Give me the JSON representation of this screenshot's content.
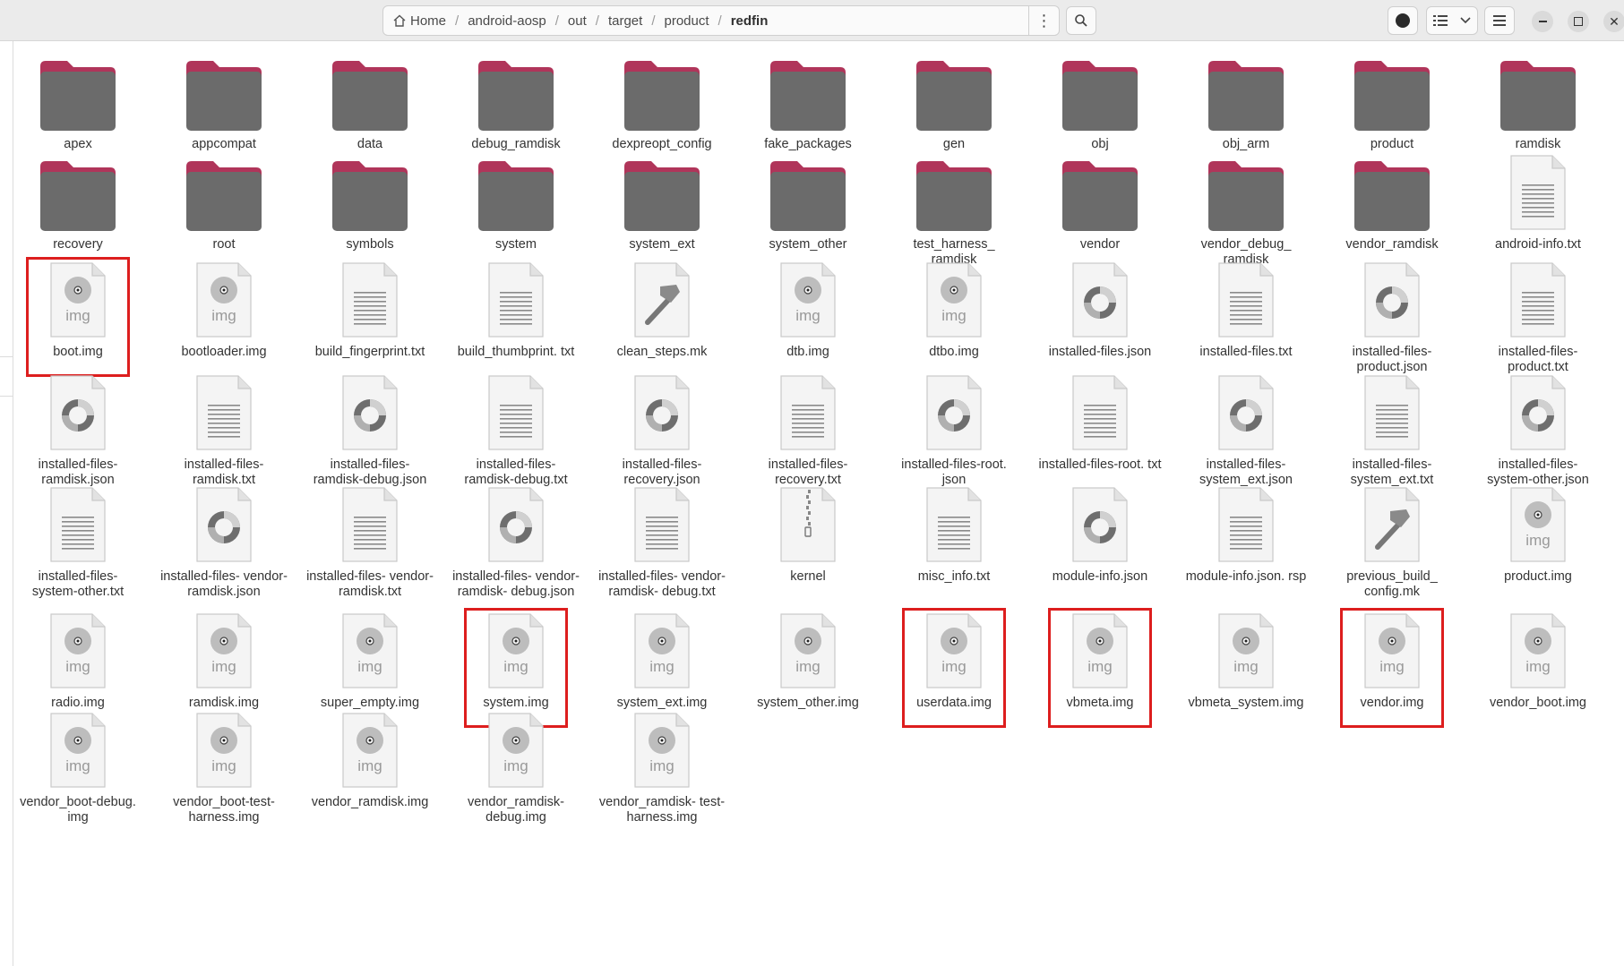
{
  "window": {
    "path": [
      "Home",
      "android-aosp",
      "out",
      "target",
      "product",
      "redfin"
    ],
    "colors": {
      "folder_tab": "#b0355a",
      "folder_body": "#6b6b6b",
      "selection": "#dd1e1e"
    }
  },
  "files": [
    {
      "name": "apex",
      "kind": "folder"
    },
    {
      "name": "appcompat",
      "kind": "folder"
    },
    {
      "name": "data",
      "kind": "folder"
    },
    {
      "name": "debug_ramdisk",
      "kind": "folder"
    },
    {
      "name": "dexpreopt_config",
      "kind": "folder"
    },
    {
      "name": "fake_packages",
      "kind": "folder"
    },
    {
      "name": "gen",
      "kind": "folder"
    },
    {
      "name": "obj",
      "kind": "folder"
    },
    {
      "name": "obj_arm",
      "kind": "folder"
    },
    {
      "name": "product",
      "kind": "folder"
    },
    {
      "name": "ramdisk",
      "kind": "folder"
    },
    {
      "name": "recovery",
      "kind": "folder"
    },
    {
      "name": "root",
      "kind": "folder"
    },
    {
      "name": "symbols",
      "kind": "folder"
    },
    {
      "name": "system",
      "kind": "folder"
    },
    {
      "name": "system_ext",
      "kind": "folder"
    },
    {
      "name": "system_other",
      "kind": "folder"
    },
    {
      "name": "test_harness_ ramdisk",
      "kind": "folder"
    },
    {
      "name": "vendor",
      "kind": "folder"
    },
    {
      "name": "vendor_debug_ ramdisk",
      "kind": "folder"
    },
    {
      "name": "vendor_ramdisk",
      "kind": "folder"
    },
    {
      "name": "android-info.txt",
      "kind": "text"
    },
    {
      "name": "boot.img",
      "kind": "img",
      "selected": true
    },
    {
      "name": "bootloader.img",
      "kind": "img"
    },
    {
      "name": "build_fingerprint.txt",
      "kind": "text"
    },
    {
      "name": "build_thumbprint. txt",
      "kind": "text"
    },
    {
      "name": "clean_steps.mk",
      "kind": "make"
    },
    {
      "name": "dtb.img",
      "kind": "img"
    },
    {
      "name": "dtbo.img",
      "kind": "img"
    },
    {
      "name": "installed-files.json",
      "kind": "json"
    },
    {
      "name": "installed-files.txt",
      "kind": "text"
    },
    {
      "name": "installed-files- product.json",
      "kind": "json"
    },
    {
      "name": "installed-files- product.txt",
      "kind": "text"
    },
    {
      "name": "installed-files- ramdisk.json",
      "kind": "json"
    },
    {
      "name": "installed-files- ramdisk.txt",
      "kind": "text"
    },
    {
      "name": "installed-files- ramdisk-debug.json",
      "kind": "json"
    },
    {
      "name": "installed-files- ramdisk-debug.txt",
      "kind": "text"
    },
    {
      "name": "installed-files- recovery.json",
      "kind": "json"
    },
    {
      "name": "installed-files- recovery.txt",
      "kind": "text"
    },
    {
      "name": "installed-files-root. json",
      "kind": "json"
    },
    {
      "name": "installed-files-root. txt",
      "kind": "text"
    },
    {
      "name": "installed-files- system_ext.json",
      "kind": "json"
    },
    {
      "name": "installed-files- system_ext.txt",
      "kind": "text"
    },
    {
      "name": "installed-files- system-other.json",
      "kind": "json"
    },
    {
      "name": "installed-files- system-other.txt",
      "kind": "text"
    },
    {
      "name": "installed-files- vendor-ramdisk.json",
      "kind": "json"
    },
    {
      "name": "installed-files- vendor-ramdisk.txt",
      "kind": "text"
    },
    {
      "name": "installed-files- vendor-ramdisk- debug.json",
      "kind": "json"
    },
    {
      "name": "installed-files- vendor-ramdisk- debug.txt",
      "kind": "text"
    },
    {
      "name": "kernel",
      "kind": "archive"
    },
    {
      "name": "misc_info.txt",
      "kind": "text"
    },
    {
      "name": "module-info.json",
      "kind": "json"
    },
    {
      "name": "module-info.json. rsp",
      "kind": "text"
    },
    {
      "name": "previous_build_ config.mk",
      "kind": "make"
    },
    {
      "name": "product.img",
      "kind": "img"
    },
    {
      "name": "radio.img",
      "kind": "img"
    },
    {
      "name": "ramdisk.img",
      "kind": "img"
    },
    {
      "name": "super_empty.img",
      "kind": "img"
    },
    {
      "name": "system.img",
      "kind": "img",
      "selected": true
    },
    {
      "name": "system_ext.img",
      "kind": "img"
    },
    {
      "name": "system_other.img",
      "kind": "img"
    },
    {
      "name": "userdata.img",
      "kind": "img",
      "selected": true
    },
    {
      "name": "vbmeta.img",
      "kind": "img",
      "selected": true
    },
    {
      "name": "vbmeta_system.img",
      "kind": "img"
    },
    {
      "name": "vendor.img",
      "kind": "img",
      "selected": true
    },
    {
      "name": "vendor_boot.img",
      "kind": "img"
    },
    {
      "name": "vendor_boot-debug. img",
      "kind": "img"
    },
    {
      "name": "vendor_boot-test- harness.img",
      "kind": "img"
    },
    {
      "name": "vendor_ramdisk.img",
      "kind": "img"
    },
    {
      "name": "vendor_ramdisk- debug.img",
      "kind": "img"
    },
    {
      "name": "vendor_ramdisk- test-harness.img",
      "kind": "img"
    }
  ]
}
